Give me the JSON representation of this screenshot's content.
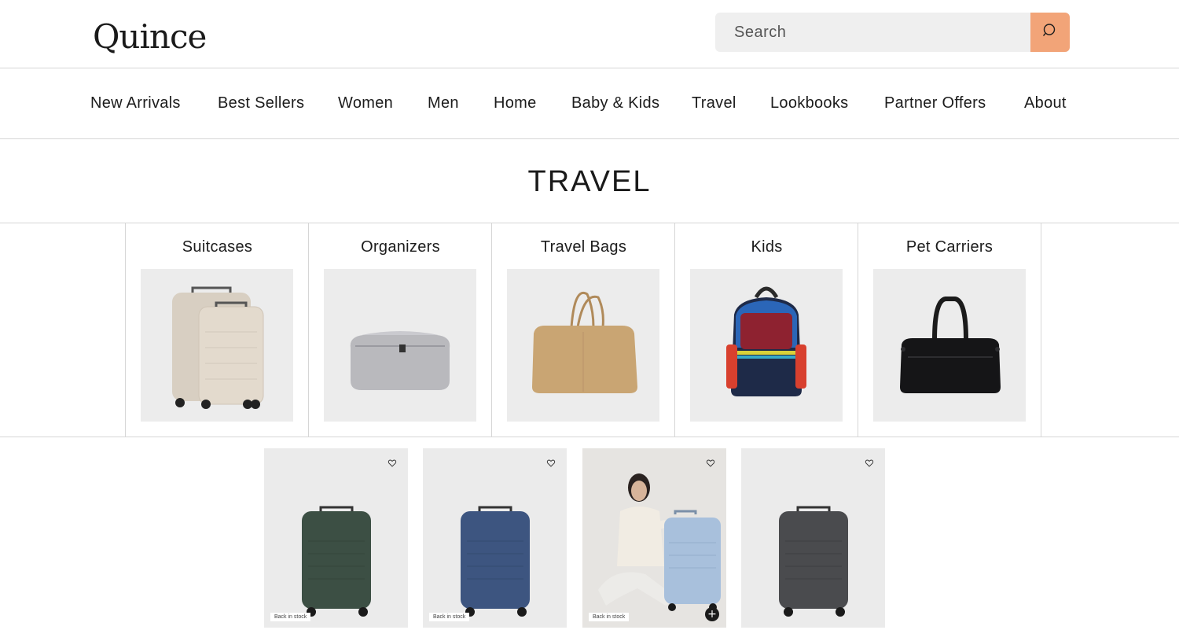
{
  "header": {
    "logo": "Quince",
    "search": {
      "placeholder": "Search"
    }
  },
  "nav": [
    {
      "label": "New Arrivals"
    },
    {
      "label": "Best Sellers"
    },
    {
      "label": "Women"
    },
    {
      "label": "Men"
    },
    {
      "label": "Home"
    },
    {
      "label": "Baby & Kids"
    },
    {
      "label": "Travel"
    },
    {
      "label": "Lookbooks"
    },
    {
      "label": "Partner Offers"
    },
    {
      "label": "About"
    }
  ],
  "page_title": "TRAVEL",
  "categories": [
    {
      "label": "Suitcases"
    },
    {
      "label": "Organizers"
    },
    {
      "label": "Travel Bags"
    },
    {
      "label": "Kids"
    },
    {
      "label": "Pet Carriers"
    }
  ],
  "products": [
    {
      "badge": "Back in stock",
      "color": "#3c4f44"
    },
    {
      "badge": "Back in stock",
      "color": "#3d5580"
    },
    {
      "badge": "Back in stock",
      "color": "#a8c0dc"
    },
    {
      "badge": "",
      "color": "#4a4b4e"
    }
  ],
  "colors": {
    "search_button": "#f2a478",
    "tile_background": "#ececec"
  }
}
